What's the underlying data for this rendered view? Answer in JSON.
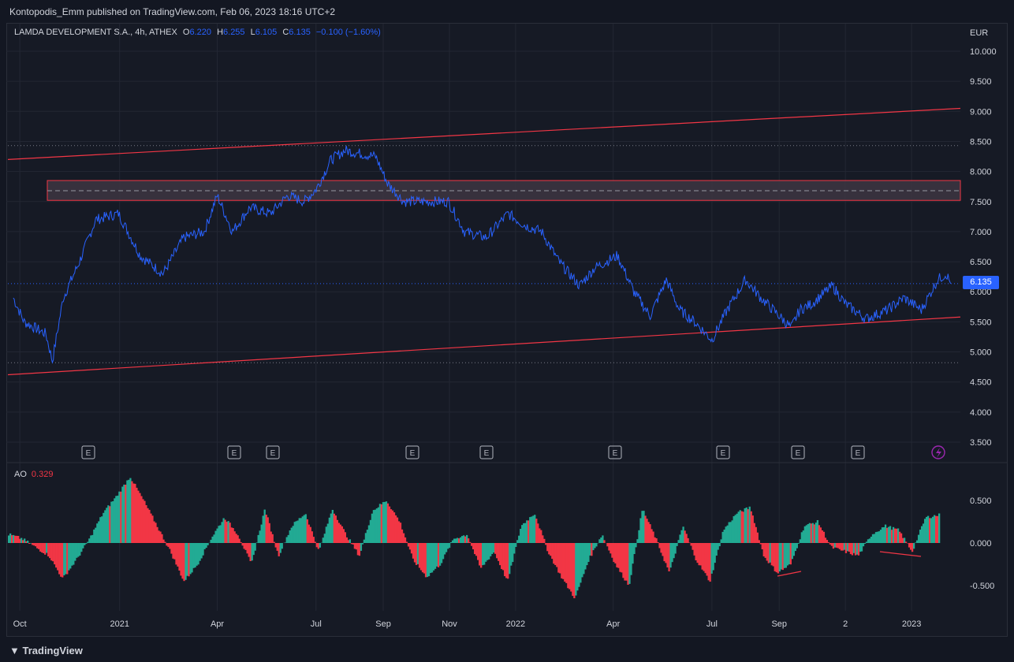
{
  "header": {
    "publish_line": "Kontopodis_Emm published on TradingView.com, Feb 06, 2023 18:16 UTC+2"
  },
  "legend": {
    "symbol": "LAMDA DEVELOPMENT S.A., 4h, ATHEX",
    "open_label": "O",
    "open": "6.220",
    "high_label": "H",
    "high": "6.255",
    "low_label": "L",
    "low": "6.105",
    "close_label": "C",
    "close": "6.135",
    "change": "−0.100 (−1.60%)"
  },
  "currency": "EUR",
  "last_price_tag": "6.135",
  "ao_legend": {
    "name": "AO",
    "value": "0.329"
  },
  "footer": {
    "brand": "TradingView"
  },
  "colors": {
    "price_line": "#2962ff",
    "channel": "#f23645",
    "ao_up": "#22ab94",
    "ao_down": "#f23645",
    "zone_fill": "#3b3440"
  },
  "events": [
    "E",
    "E",
    "E",
    "E",
    "E",
    "E",
    "E",
    "E",
    "E"
  ],
  "chart_data": [
    {
      "type": "line",
      "title": "LAMDA DEVELOPMENT S.A., 4h, ATHEX",
      "ylabel": "EUR",
      "ylim": [
        3.3,
        10.3
      ],
      "x_tick_labels": [
        "Oct",
        "2021",
        "Apr",
        "Jul",
        "Sep",
        "Nov",
        "2022",
        "Apr",
        "Jul",
        "Sep",
        "2",
        "2023"
      ],
      "y_tick_labels": [
        "10.000",
        "9.500",
        "9.000",
        "8.500",
        "8.000",
        "7.500",
        "7.000",
        "6.500",
        "6.000",
        "5.500",
        "5.000",
        "4.500",
        "4.000",
        "3.500"
      ],
      "series": [
        {
          "values_x": [
            "2020-09-25",
            "2020-10-05",
            "2020-10-25",
            "2020-10-31",
            "2020-11-10",
            "2020-11-25",
            "2020-12-10",
            "2020-12-31",
            "2021-01-20",
            "2021-02-10",
            "2021-03-01",
            "2021-03-20",
            "2021-04-01",
            "2021-04-15",
            "2021-05-01",
            "2021-05-20",
            "2021-06-05",
            "2021-06-20",
            "2021-07-01",
            "2021-07-15",
            "2021-07-28",
            "2021-08-10",
            "2021-08-25",
            "2021-09-05",
            "2021-09-20",
            "2021-10-10",
            "2021-10-31",
            "2021-11-15",
            "2021-12-05",
            "2021-12-25",
            "2022-01-10",
            "2022-01-25",
            "2022-02-10",
            "2022-03-01",
            "2022-03-15",
            "2022-04-05",
            "2022-04-20",
            "2022-05-05",
            "2022-05-20",
            "2022-06-01",
            "2022-06-15",
            "2022-07-01",
            "2022-07-15",
            "2022-08-01",
            "2022-08-15",
            "2022-09-01",
            "2022-09-12",
            "2022-09-20",
            "2022-10-01",
            "2022-10-20",
            "2022-11-01",
            "2022-11-20",
            "2022-12-10",
            "2022-12-25",
            "2023-01-10",
            "2023-01-25",
            "2023-02-02",
            "2023-02-06"
          ],
          "values": [
            5.9,
            5.5,
            5.3,
            4.85,
            5.9,
            6.5,
            7.2,
            7.3,
            6.6,
            6.3,
            6.9,
            7.0,
            7.6,
            7.0,
            7.4,
            7.3,
            7.6,
            7.5,
            7.7,
            8.2,
            8.35,
            8.3,
            8.25,
            7.8,
            7.5,
            7.5,
            7.5,
            7.0,
            6.9,
            7.3,
            7.1,
            7.0,
            6.5,
            6.1,
            6.4,
            6.6,
            6.0,
            5.6,
            6.2,
            5.7,
            5.5,
            5.2,
            5.7,
            6.2,
            5.9,
            5.6,
            5.4,
            5.7,
            5.8,
            6.1,
            5.8,
            5.55,
            5.7,
            5.9,
            5.7,
            6.2,
            6.3,
            6.135
          ]
        }
      ],
      "horizontal_zone": {
        "low": 7.52,
        "high": 7.85,
        "mid": 7.68
      },
      "channel_upper": {
        "start": 8.2,
        "end": 9.05
      },
      "channel_lower": {
        "start": 4.62,
        "end": 5.58
      },
      "reference_lines": [
        8.43,
        4.82,
        6.135
      ]
    },
    {
      "type": "bar",
      "title": "AO",
      "ylim": [
        -0.7,
        0.8
      ],
      "y_tick_labels": [
        "0.500",
        "0.000",
        "-0.500"
      ],
      "series": [
        {
          "name": "AO",
          "values": [
            0.1,
            0.05,
            -0.05,
            -0.15,
            -0.42,
            -0.2,
            0.05,
            0.35,
            0.55,
            0.78,
            0.5,
            0.2,
            -0.1,
            -0.45,
            -0.25,
            0.05,
            0.3,
            0.1,
            -0.25,
            0.4,
            -0.15,
            0.2,
            0.35,
            -0.1,
            0.4,
            0.1,
            -0.15,
            0.38,
            0.5,
            0.25,
            -0.2,
            -0.4,
            -0.25,
            0.05,
            0.1,
            -0.3,
            -0.1,
            -0.45,
            0.2,
            0.35,
            -0.1,
            -0.4,
            -0.65,
            -0.2,
            0.1,
            -0.25,
            -0.5,
            0.4,
            0.05,
            -0.35,
            0.2,
            -0.2,
            -0.45,
            0.15,
            0.35,
            0.42,
            -0.15,
            -0.35,
            -0.25,
            0.2,
            0.25,
            -0.05,
            -0.1,
            -0.15,
            0.1,
            0.2,
            0.15,
            -0.1,
            0.3,
            0.33
          ]
        }
      ]
    }
  ]
}
